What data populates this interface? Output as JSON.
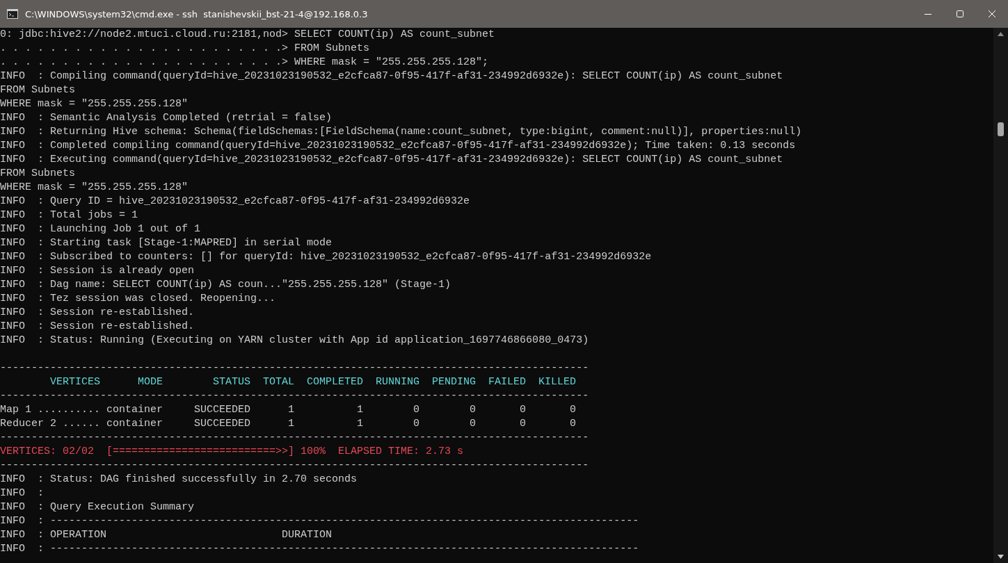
{
  "window": {
    "title": "C:\\WINDOWS\\system32\\cmd.exe - ssh  stanishevskii_bst-21-4@192.168.0.3"
  },
  "terminal": {
    "lines": [
      {
        "kind": "text",
        "text": "0: jdbc:hive2://node2.mtuci.cloud.ru:2181,nod> SELECT COUNT(ip) AS count_subnet"
      },
      {
        "kind": "text",
        "text": ". . . . . . . . . . . . . . . . . . . . . . .> FROM Subnets"
      },
      {
        "kind": "text",
        "text": ". . . . . . . . . . . . . . . . . . . . . . .> WHERE mask = \"255.255.255.128\";"
      },
      {
        "kind": "text",
        "text": "INFO  : Compiling command(queryId=hive_20231023190532_e2cfca87-0f95-417f-af31-234992d6932e): SELECT COUNT(ip) AS count_subnet"
      },
      {
        "kind": "text",
        "text": "FROM Subnets"
      },
      {
        "kind": "text",
        "text": "WHERE mask = \"255.255.255.128\""
      },
      {
        "kind": "text",
        "text": "INFO  : Semantic Analysis Completed (retrial = false)"
      },
      {
        "kind": "text",
        "text": "INFO  : Returning Hive schema: Schema(fieldSchemas:[FieldSchema(name:count_subnet, type:bigint, comment:null)], properties:null)"
      },
      {
        "kind": "text",
        "text": "INFO  : Completed compiling command(queryId=hive_20231023190532_e2cfca87-0f95-417f-af31-234992d6932e); Time taken: 0.13 seconds"
      },
      {
        "kind": "text",
        "text": "INFO  : Executing command(queryId=hive_20231023190532_e2cfca87-0f95-417f-af31-234992d6932e): SELECT COUNT(ip) AS count_subnet"
      },
      {
        "kind": "text",
        "text": "FROM Subnets"
      },
      {
        "kind": "text",
        "text": "WHERE mask = \"255.255.255.128\""
      },
      {
        "kind": "text",
        "text": "INFO  : Query ID = hive_20231023190532_e2cfca87-0f95-417f-af31-234992d6932e"
      },
      {
        "kind": "text",
        "text": "INFO  : Total jobs = 1"
      },
      {
        "kind": "text",
        "text": "INFO  : Launching Job 1 out of 1"
      },
      {
        "kind": "text",
        "text": "INFO  : Starting task [Stage-1:MAPRED] in serial mode"
      },
      {
        "kind": "text",
        "text": "INFO  : Subscribed to counters: [] for queryId: hive_20231023190532_e2cfca87-0f95-417f-af31-234992d6932e"
      },
      {
        "kind": "text",
        "text": "INFO  : Session is already open"
      },
      {
        "kind": "text",
        "text": "INFO  : Dag name: SELECT COUNT(ip) AS coun...\"255.255.255.128\" (Stage-1)"
      },
      {
        "kind": "text",
        "text": "INFO  : Tez session was closed. Reopening..."
      },
      {
        "kind": "text",
        "text": "INFO  : Session re-established."
      },
      {
        "kind": "text",
        "text": "INFO  : Session re-established."
      },
      {
        "kind": "text",
        "text": "INFO  : Status: Running (Executing on YARN cluster with App id application_1697746866080_0473)"
      },
      {
        "kind": "blank"
      },
      {
        "kind": "text",
        "text": "----------------------------------------------------------------------------------------------"
      },
      {
        "kind": "table_header",
        "cells": [
          "VERTICES",
          "MODE",
          "STATUS",
          "TOTAL",
          "COMPLETED",
          "RUNNING",
          "PENDING",
          "FAILED",
          "KILLED"
        ]
      },
      {
        "kind": "text",
        "text": "----------------------------------------------------------------------------------------------"
      },
      {
        "kind": "table_row",
        "cells": [
          "Map 1 ..........",
          "container",
          "SUCCEEDED",
          "1",
          "1",
          "0",
          "0",
          "0",
          "0"
        ]
      },
      {
        "kind": "table_row",
        "cells": [
          "Reducer 2 ......",
          "container",
          "SUCCEEDED",
          "1",
          "1",
          "0",
          "0",
          "0",
          "0"
        ]
      },
      {
        "kind": "text",
        "text": "----------------------------------------------------------------------------------------------"
      },
      {
        "kind": "alert",
        "text": "VERTICES: 02/02  [==========================>>] 100%  ELAPSED TIME: 2.73 s"
      },
      {
        "kind": "text",
        "text": "----------------------------------------------------------------------------------------------"
      },
      {
        "kind": "text",
        "text": "INFO  : Status: DAG finished successfully in 2.70 seconds"
      },
      {
        "kind": "text",
        "text": "INFO  :"
      },
      {
        "kind": "text",
        "text": "INFO  : Query Execution Summary"
      },
      {
        "kind": "text",
        "text": "INFO  : ----------------------------------------------------------------------------------------------"
      },
      {
        "kind": "text",
        "text": "INFO  : OPERATION                            DURATION"
      },
      {
        "kind": "text",
        "text": "INFO  : ----------------------------------------------------------------------------------------------"
      }
    ]
  }
}
